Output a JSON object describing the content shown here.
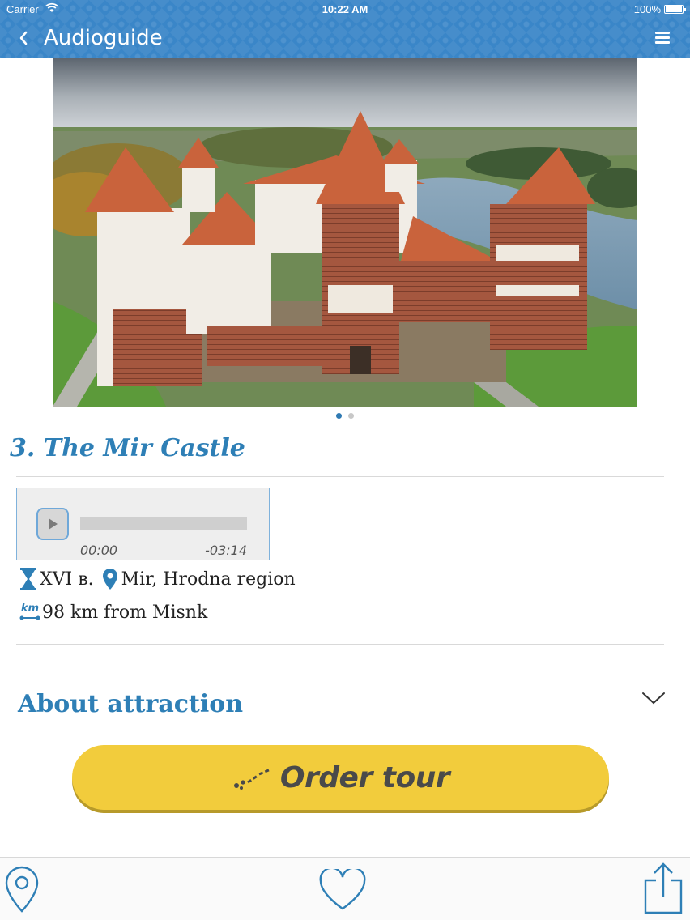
{
  "status_bar": {
    "carrier": "Carrier",
    "time": "10:22 AM",
    "battery": "100%"
  },
  "nav": {
    "title": "Audioguide",
    "back_icon": "chevron-left-icon",
    "menu_icon": "hamburger-menu-icon"
  },
  "gallery": {
    "pages": 2,
    "current_page": 1
  },
  "attraction": {
    "title": "3. The Mir Castle",
    "century": "XVI в.",
    "location": "Mir, Hrodna region",
    "distance": "98 km from Misnk",
    "distance_badge": "km"
  },
  "player": {
    "elapsed": "00:00",
    "remaining": "-03:14",
    "progress": 0
  },
  "about": {
    "label": "About attraction"
  },
  "order": {
    "label": "Order tour"
  },
  "toolbar": {
    "items": [
      "map-pin-icon",
      "heart-icon",
      "share-icon"
    ]
  },
  "colors": {
    "accent": "#2e7fb6",
    "navbar": "#3a86c8",
    "order_button": "#f2cc3c"
  }
}
